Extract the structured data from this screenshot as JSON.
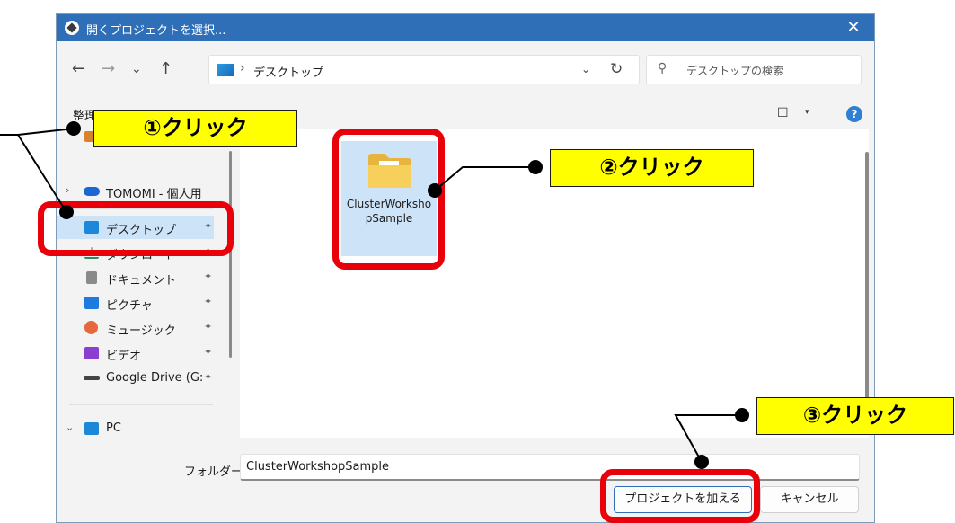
{
  "window": {
    "title": "開くプロジェクトを選択...",
    "close_glyph": "✕"
  },
  "nav": {
    "back": "←",
    "forward": "→",
    "recent": "⌄",
    "up": "↑",
    "address_sep": "›",
    "address_crumb": "デスクトップ",
    "address_dropdown": "⌄",
    "refresh": "↻",
    "search_glyph": "⚲",
    "search_placeholder": "デスクトップの検索"
  },
  "toolbar": {
    "organize_partial": "整理",
    "view_glyph": "☐",
    "view_dropdown": "▾",
    "help": "?"
  },
  "sidebar": {
    "onedrive_expander": "›",
    "onedrive": "TOMOMI - 個人用",
    "items": [
      {
        "label": "デスクトップ",
        "icon": "desktop-icon",
        "color": "#1e88d8"
      },
      {
        "label": "ダウンロード",
        "icon": "download-icon",
        "color": "#2e8b57"
      },
      {
        "label": "ドキュメント",
        "icon": "document-icon",
        "color": "#7a7a7a"
      },
      {
        "label": "ピクチャ",
        "icon": "pictures-icon",
        "color": "#1f7ae0"
      },
      {
        "label": "ミュージック",
        "icon": "music-icon",
        "color": "#e5683e"
      },
      {
        "label": "ビデオ",
        "icon": "video-icon",
        "color": "#8a3fd1"
      },
      {
        "label": "Google Drive (G:",
        "icon": "drive-icon",
        "color": "#444444"
      }
    ],
    "pin_glyph": "📌",
    "pc_expander": "⌄",
    "pc_label": "PC"
  },
  "content": {
    "folder_name": "ClusterWorkshopSample"
  },
  "bottom": {
    "folder_label": "フォルダー:",
    "folder_value": "ClusterWorkshopSample",
    "primary_button": "プロジェクトを加える",
    "cancel_button": "キャンセル"
  },
  "annotations": {
    "step1": "①クリック",
    "step2": "②クリック",
    "step3": "③クリック"
  },
  "colors": {
    "titlebar": "#2f6fb7",
    "highlight_red": "#e8000b",
    "callout_yellow": "#ffff00",
    "selection": "#cde3f8"
  }
}
